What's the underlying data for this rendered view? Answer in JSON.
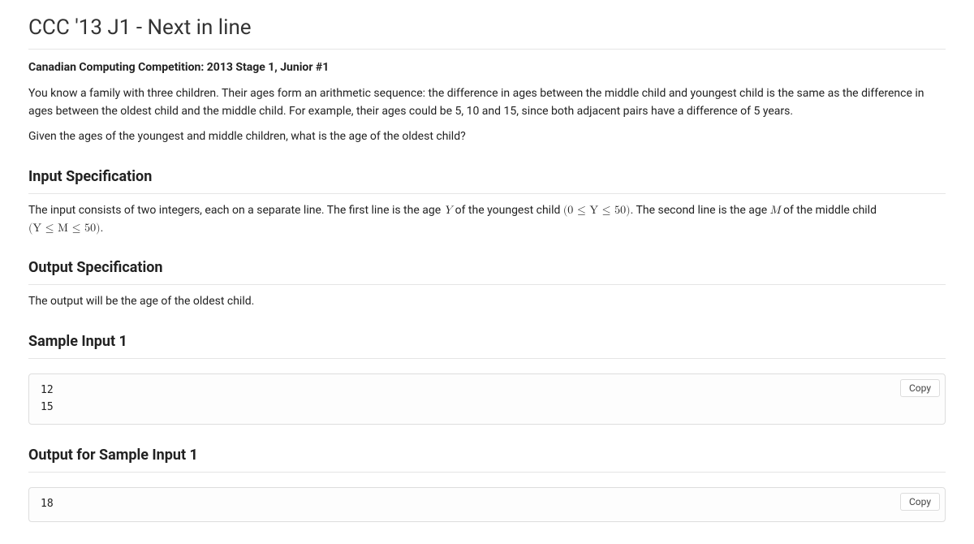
{
  "title": "CCC '13 J1 - Next in line",
  "subtitle": "Canadian Computing Competition: 2013 Stage 1, Junior #1",
  "intro_p1": "You know a family with three children. Their ages form an arithmetic sequence: the difference in ages between the middle child and youngest child is the same as the difference in ages between the oldest child and the middle child. For example, their ages could be 5, 10 and 15, since both adjacent pairs have a difference of 5 years.",
  "intro_p2": "Given the ages of the youngest and middle children, what is the age of the oldest child?",
  "headings": {
    "input_spec": "Input Specification",
    "output_spec": "Output Specification",
    "sample_input_1": "Sample Input 1",
    "sample_output_1": "Output for Sample Input 1"
  },
  "input_spec": {
    "pre": "The input consists of two integers, each on a separate line. The first line is the age ",
    "var_Y": "Y",
    "mid1": " of the youngest child ",
    "range_Y": "(0 ≤ Y ≤ 50)",
    "mid2": ". The second line is the age ",
    "var_M": "M",
    "mid3": " of the middle child ",
    "range_M": "(Y ≤ M ≤ 50)",
    "post": "."
  },
  "output_spec": "The output will be the age of the oldest child.",
  "sample_input_1_code": "12\n15",
  "sample_output_1_code": "18",
  "copy_label": "Copy"
}
